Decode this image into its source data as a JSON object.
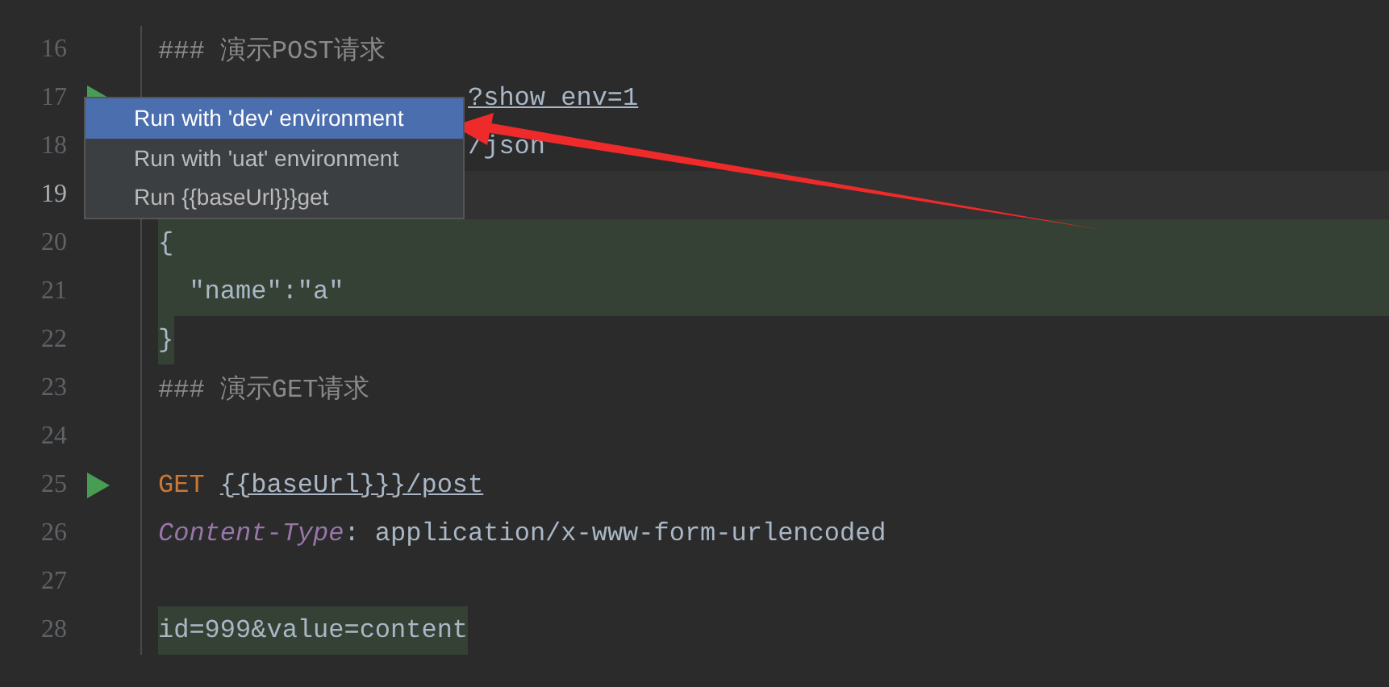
{
  "editor": {
    "lines": [
      {
        "number": "16",
        "current": false,
        "run": false,
        "kind": "plain",
        "tokens": [
          {
            "kind": "comment",
            "text": "### 演示POST请求"
          }
        ]
      },
      {
        "number": "17",
        "current": false,
        "run": true,
        "kind": "plain",
        "tokens": [
          {
            "kind": "tail",
            "text": "?show_env=1"
          }
        ]
      },
      {
        "number": "18",
        "current": false,
        "kind": "plain",
        "tokens": [
          {
            "kind": "tail",
            "text": "/json"
          }
        ]
      },
      {
        "number": "19",
        "current": true,
        "kind": "plain"
      },
      {
        "number": "20",
        "current": false,
        "run": false,
        "kind": "fragment",
        "tokens": [
          {
            "kind": "plain",
            "text": "{"
          }
        ]
      },
      {
        "number": "21",
        "current": false,
        "run": false,
        "kind": "fragment",
        "tokens": [
          {
            "kind": "plain",
            "text": "  \"name\":\"a\""
          }
        ]
      },
      {
        "number": "22",
        "current": false,
        "run": false,
        "kind": "marked",
        "tokens": [
          {
            "kind": "plain",
            "text": "}"
          }
        ]
      },
      {
        "number": "23",
        "current": false,
        "run": false,
        "kind": "plain",
        "tokens": [
          {
            "kind": "comment",
            "text": "### 演示GET请求"
          }
        ]
      },
      {
        "number": "24",
        "current": false,
        "run": false,
        "kind": "plain"
      },
      {
        "number": "25",
        "current": false,
        "run": true,
        "kind": "plain",
        "tokens": [
          {
            "kind": "keyword",
            "text": "GET"
          },
          {
            "kind": "url",
            "text": "{{baseUrl}}}/post"
          }
        ]
      },
      {
        "number": "26",
        "current": false,
        "run": false,
        "kind": "plain",
        "tokens": [
          {
            "kind": "header",
            "text": "Content-Type"
          },
          {
            "kind": "plain",
            "text": ": application/x-www-form-urlencoded"
          }
        ]
      },
      {
        "number": "27",
        "current": false,
        "run": false,
        "kind": "plain"
      },
      {
        "number": "28",
        "current": false,
        "run": false,
        "kind": "marked",
        "tokens": [
          {
            "kind": "plain",
            "text": "id=999&value=content"
          }
        ]
      }
    ]
  },
  "popup_menu": {
    "items": [
      {
        "label": "Run with 'dev' environment",
        "selected": true
      },
      {
        "label": "Run with 'uat' environment",
        "selected": false
      },
      {
        "label": "Run {{baseUrl}}}get",
        "selected": false
      }
    ]
  }
}
